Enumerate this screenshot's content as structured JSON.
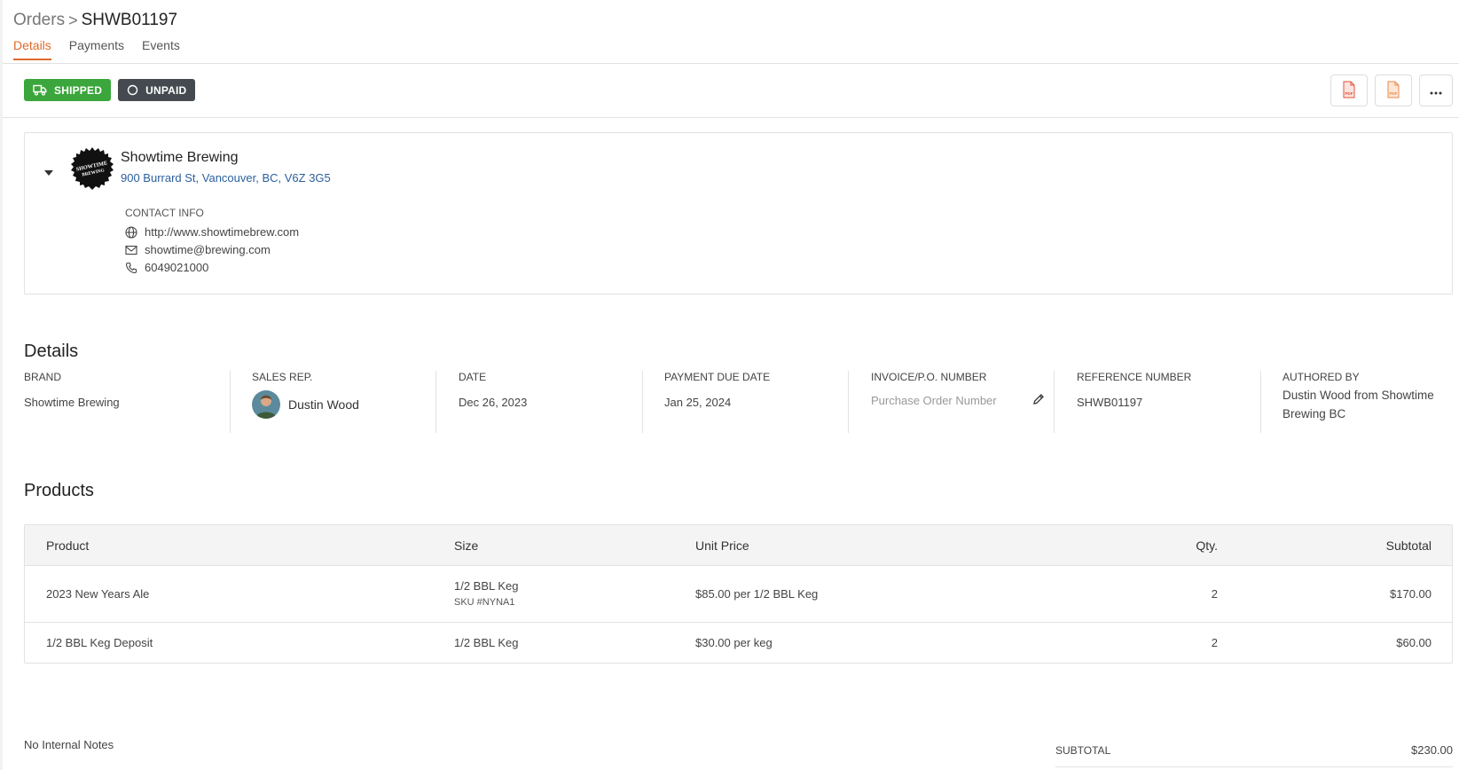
{
  "breadcrumb": {
    "parent": "Orders",
    "separator": ">",
    "current": "SHWB01197"
  },
  "tabs": [
    {
      "label": "Details",
      "active": true
    },
    {
      "label": "Payments",
      "active": false
    },
    {
      "label": "Events",
      "active": false
    }
  ],
  "status": {
    "shipped": {
      "label": "SHIPPED",
      "color": "#3aa63b",
      "icon": "truck-icon"
    },
    "payment": {
      "label": "UNPAID",
      "color": "#444a50",
      "icon": "circle-icon"
    }
  },
  "actions": [
    {
      "icon": "pdf-icon",
      "label": "PDF"
    },
    {
      "icon": "pdf-icon",
      "label": "PDF"
    },
    {
      "icon": "more-icon",
      "label": "..."
    }
  ],
  "company": {
    "name": "Showtime Brewing",
    "address": "900 Burrard St, Vancouver, BC, V6Z 3G5",
    "logo_text": [
      "SHOWTIME",
      "BREWING"
    ],
    "contact_title": "CONTACT INFO",
    "website": "http://www.showtimebrew.com",
    "email": "showtime@brewing.com",
    "phone": "6049021000"
  },
  "details": {
    "title": "Details",
    "brand": {
      "label": "BRAND",
      "value": "Showtime Brewing"
    },
    "sales_rep": {
      "label": "SALES REP.",
      "value": "Dustin Wood"
    },
    "date": {
      "label": "DATE",
      "value": "Dec 26, 2023"
    },
    "due_date": {
      "label": "PAYMENT DUE DATE",
      "value": "Jan 25, 2024"
    },
    "invoice": {
      "label": "INVOICE/P.O. NUMBER",
      "placeholder": "Purchase Order Number",
      "value": ""
    },
    "reference": {
      "label": "REFERENCE NUMBER",
      "value": "SHWB01197"
    },
    "author": {
      "label": "AUTHORED BY",
      "value": "Dustin Wood from Showtime Brewing BC"
    }
  },
  "products": {
    "title": "Products",
    "headers": {
      "product": "Product",
      "size": "Size",
      "unit_price": "Unit Price",
      "qty": "Qty.",
      "subtotal": "Subtotal"
    },
    "rows": [
      {
        "product": "2023 New Years Ale",
        "size": "1/2 BBL Keg",
        "sku": "SKU #NYNA1",
        "unit_price": "$85.00 per 1/2 BBL Keg",
        "qty": "2",
        "subtotal": "$170.00"
      },
      {
        "product": "1/2 BBL Keg Deposit",
        "size": "1/2 BBL Keg",
        "sku": "",
        "unit_price": "$30.00 per keg",
        "qty": "2",
        "subtotal": "$60.00"
      }
    ]
  },
  "notes": "No Internal Notes",
  "totals": {
    "subtotal_label": "SUBTOTAL",
    "subtotal_value": "$230.00"
  }
}
